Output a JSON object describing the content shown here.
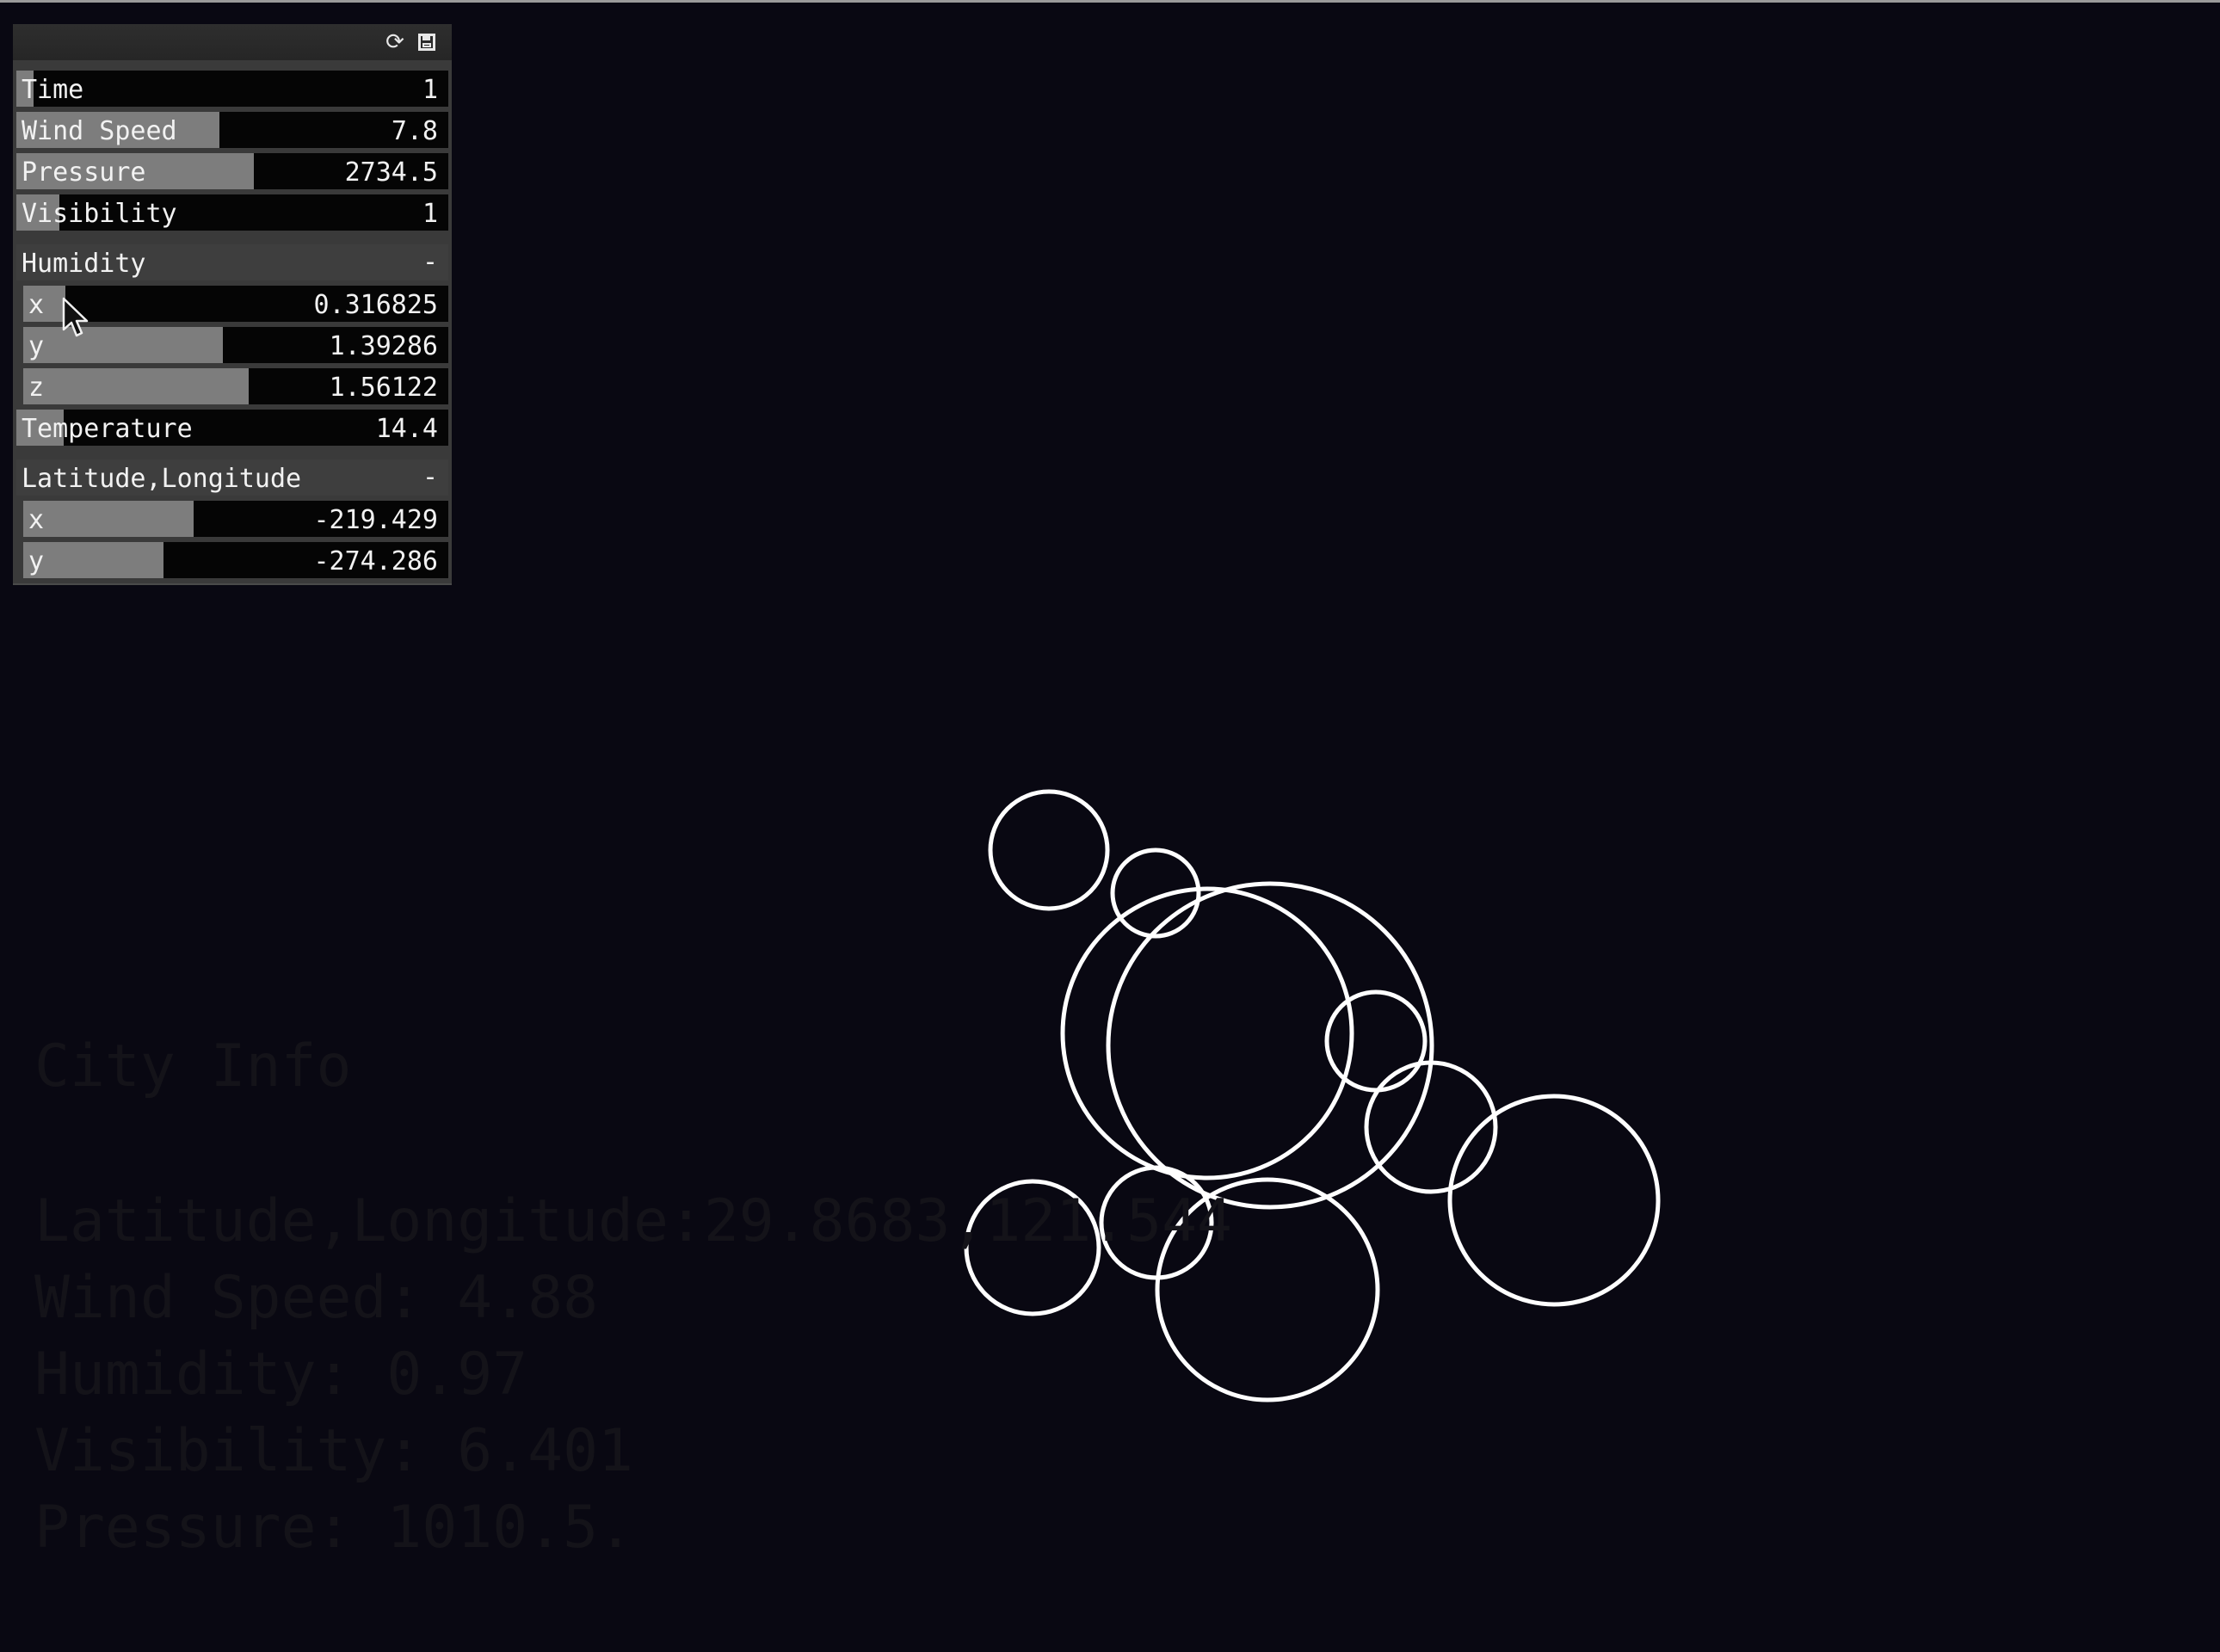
{
  "panel": {
    "header_icons": [
      "refresh-icon",
      "save-icon"
    ],
    "sliders": [
      {
        "label": "Time",
        "value": "1",
        "level": 0.04
      },
      {
        "label": "Wind Speed",
        "value": "7.8",
        "level": 0.47
      },
      {
        "label": "Pressure",
        "value": "2734.5",
        "level": 0.55
      },
      {
        "label": "Visibility",
        "value": "1",
        "level": 0.1
      }
    ],
    "humidity": {
      "title": "Humidity",
      "collapse": "-",
      "x": {
        "label": "x",
        "value": "0.316825",
        "level": 0.1
      },
      "y": {
        "label": "y",
        "value": "1.39286",
        "level": 0.47
      },
      "z": {
        "label": "z",
        "value": "1.56122",
        "level": 0.53
      }
    },
    "temperature": {
      "label": "Temperature",
      "value": "14.4",
      "level": 0.11
    },
    "latlon": {
      "title": "Latitude,Longitude",
      "collapse": "-",
      "x": {
        "label": "x",
        "value": "-219.429",
        "level": 0.4
      },
      "y": {
        "label": "y",
        "value": "-274.286",
        "level": 0.33
      }
    }
  },
  "city_info": {
    "title": "City Info",
    "lat_lon": "Latitude,Longitude:29.8683,121.544",
    "wind_speed": "Wind Speed: 4.88",
    "humidity": "Humidity: 0.97",
    "visibility": "Visibility: 6.401",
    "pressure": "Pressure: 1010.5."
  },
  "colors": {
    "background": "#090812",
    "circle_stroke": "#ffffff",
    "slider_fill": "#7d7d7d",
    "info_text": "#141319"
  }
}
